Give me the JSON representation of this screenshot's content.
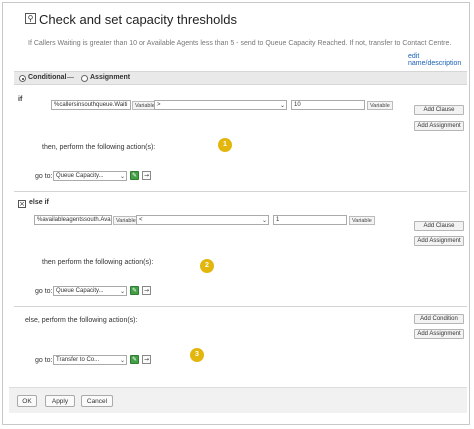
{
  "dialog": {
    "title": "Check and set capacity thresholds",
    "description": "If Callers Waiting is greater than 10 or Available Agents less than 5 - send to Queue Capacity Reached. If not, transfer to Contact Centre.",
    "edit_link": "edit name/description"
  },
  "mode": {
    "conditional_label": "Conditional",
    "separator": "—",
    "assignment_label": "Assignment",
    "selected": "Conditional"
  },
  "if_block": {
    "label": "if",
    "left_value": "%callersinsouthqueue.Waiti",
    "left_tag": "Variable",
    "operator": ">",
    "right_value": "10",
    "right_tag": "Variable",
    "add_clause": "Add Clause",
    "add_assignment": "Add Assignment",
    "then_label": "then, perform the following action(s):",
    "goto_label": "go to:",
    "goto_value": "Queue Capacity...",
    "badge": "1"
  },
  "else_if_block": {
    "label": "else if",
    "left_value": "%availableagentssouth.Avai",
    "left_tag": "Variable",
    "operator": "<",
    "right_value": "1",
    "right_tag": "Variable",
    "add_clause": "Add Clause",
    "add_assignment": "Add Assignment",
    "then_label": "then perform the following action(s):",
    "goto_label": "go to:",
    "goto_value": "Queue Capacity...",
    "badge": "2"
  },
  "else_block": {
    "label": "else, perform the following action(s):",
    "add_condition": "Add Condition",
    "add_assignment": "Add Assignment",
    "goto_label": "go to:",
    "goto_value": "Transfer to Co...",
    "badge": "3"
  },
  "footer": {
    "ok": "OK",
    "apply": "Apply",
    "cancel": "Cancel"
  },
  "icons": {
    "title": "node-icon",
    "remove": "close-box-icon",
    "edit": "edit-green-icon",
    "go": "arrow-right-icon",
    "dropdown": "chevron-down-icon"
  },
  "colors": {
    "badge": "#e3b60d",
    "link": "#1a5fb4",
    "edit_button": "#43a047"
  }
}
